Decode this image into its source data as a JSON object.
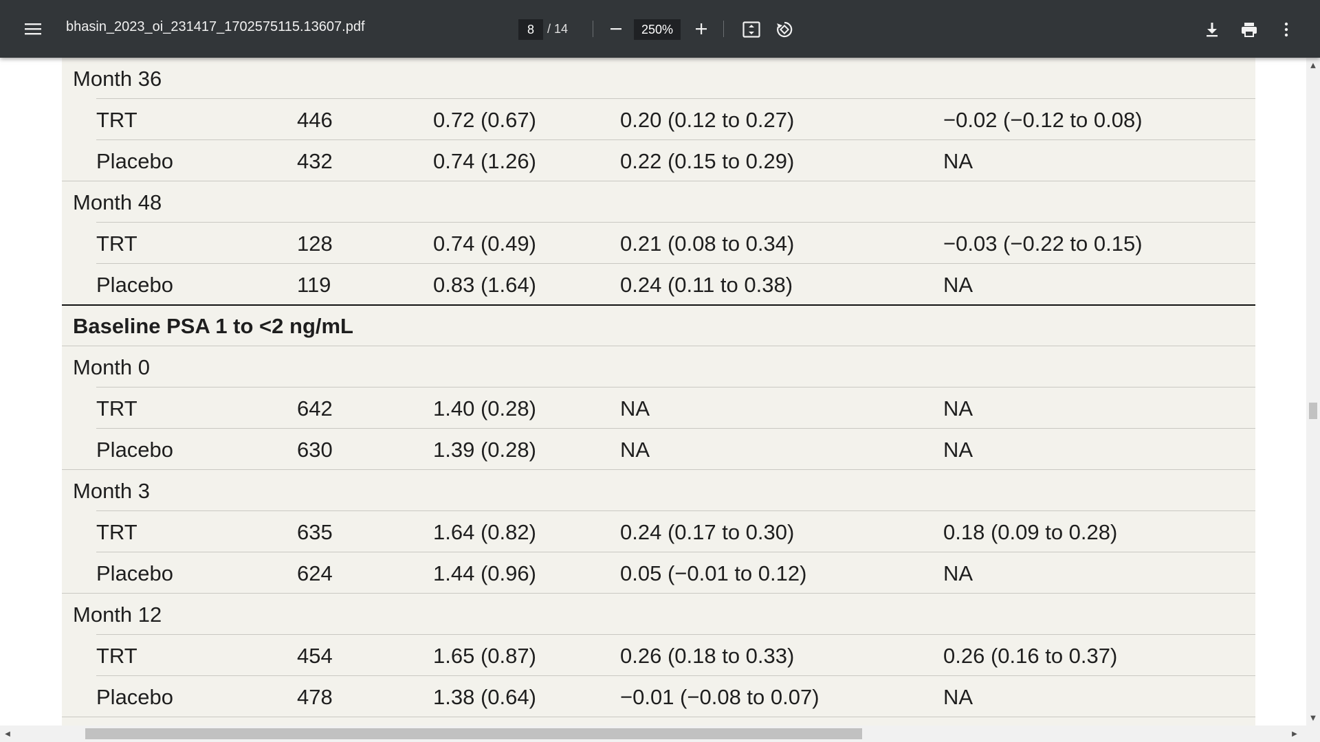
{
  "toolbar": {
    "menu_icon": "hamburger-menu-icon",
    "title": "bhasin_2023_oi_231417_1702575115.13607.pdf",
    "page_current": "8",
    "page_total": "/ 14",
    "zoom": "250%",
    "icons": [
      "minus-icon",
      "plus-icon",
      "fit-page-icon",
      "rotate-icon",
      "download-icon",
      "print-icon",
      "more-vert-icon"
    ]
  },
  "table": {
    "rows": [
      {
        "kind": "group",
        "label": "Month 36"
      },
      {
        "kind": "data",
        "label": "TRT",
        "n": "446",
        "mean": "0.72 (0.67)",
        "change": "0.20 (0.12 to 0.27)",
        "diff": "−0.02 (−0.12 to 0.08)"
      },
      {
        "kind": "data",
        "label": "Placebo",
        "n": "432",
        "mean": "0.74 (1.26)",
        "change": "0.22 (0.15 to 0.29)",
        "diff": "NA"
      },
      {
        "kind": "group",
        "label": "Month 48"
      },
      {
        "kind": "data",
        "label": "TRT",
        "n": "128",
        "mean": "0.74 (0.49)",
        "change": "0.21 (0.08 to 0.34)",
        "diff": "−0.03 (−0.22 to 0.15)"
      },
      {
        "kind": "data",
        "label": "Placebo",
        "n": "119",
        "mean": "0.83 (1.64)",
        "change": "0.24 (0.11 to 0.38)",
        "diff": "NA"
      },
      {
        "kind": "section",
        "label": "Baseline PSA 1 to <2 ng/mL"
      },
      {
        "kind": "group",
        "label": "Month 0"
      },
      {
        "kind": "data",
        "label": "TRT",
        "n": "642",
        "mean": "1.40 (0.28)",
        "change": "NA",
        "diff": "NA"
      },
      {
        "kind": "data",
        "label": "Placebo",
        "n": "630",
        "mean": "1.39 (0.28)",
        "change": "NA",
        "diff": "NA"
      },
      {
        "kind": "group",
        "label": "Month 3"
      },
      {
        "kind": "data",
        "label": "TRT",
        "n": "635",
        "mean": "1.64 (0.82)",
        "change": "0.24 (0.17 to 0.30)",
        "diff": "0.18 (0.09 to 0.28)"
      },
      {
        "kind": "data",
        "label": "Placebo",
        "n": "624",
        "mean": "1.44 (0.96)",
        "change": "0.05 (−0.01 to 0.12)",
        "diff": "NA"
      },
      {
        "kind": "group",
        "label": "Month 12"
      },
      {
        "kind": "data",
        "label": "TRT",
        "n": "454",
        "mean": "1.65 (0.87)",
        "change": "0.26 (0.18 to 0.33)",
        "diff": "0.26 (0.16 to 0.37)"
      },
      {
        "kind": "data",
        "label": "Placebo",
        "n": "478",
        "mean": "1.38 (0.64)",
        "change": "−0.01 (−0.08 to 0.07)",
        "diff": "NA"
      }
    ]
  }
}
